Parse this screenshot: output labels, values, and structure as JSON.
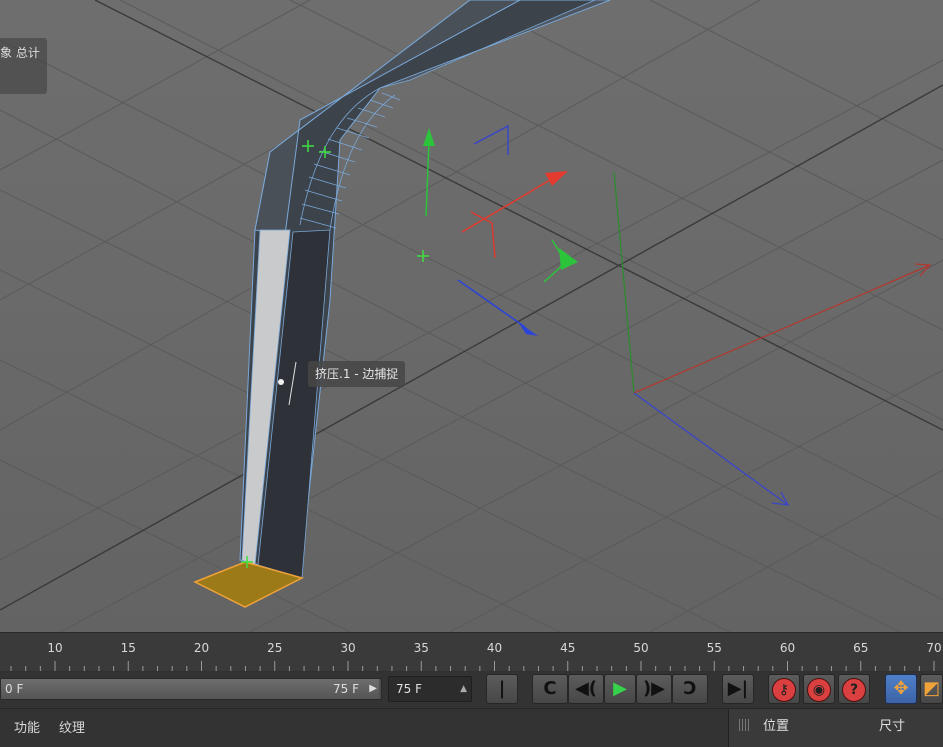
{
  "viewport": {
    "hud_text": "象 总计",
    "tooltip": "挤压.1 - 边捕捉"
  },
  "timeline": {
    "ticks": [
      "10",
      "15",
      "20",
      "25",
      "30",
      "35",
      "40",
      "45",
      "50",
      "55",
      "60",
      "65",
      "70"
    ]
  },
  "transport": {
    "range_start": "0 F",
    "range_end": "75 F",
    "current_frame": "75 F",
    "buttons": {
      "goto_start": "|◀◀",
      "prev_key": "C",
      "step_back": "◀(",
      "play": "▶",
      "step_forward": ")▶",
      "next_key": "Ↄ",
      "goto_end": "▶|"
    }
  },
  "bottom": {
    "menu_function": "功能",
    "menu_texture": "纹理",
    "panel_position": "位置",
    "panel_size": "尺寸"
  },
  "colors": {
    "selection": "#f0a23a",
    "axis_x": "#e53b2f",
    "axis_y": "#2bc43a",
    "axis_z": "#2b43d8",
    "object": "#3d434b"
  }
}
